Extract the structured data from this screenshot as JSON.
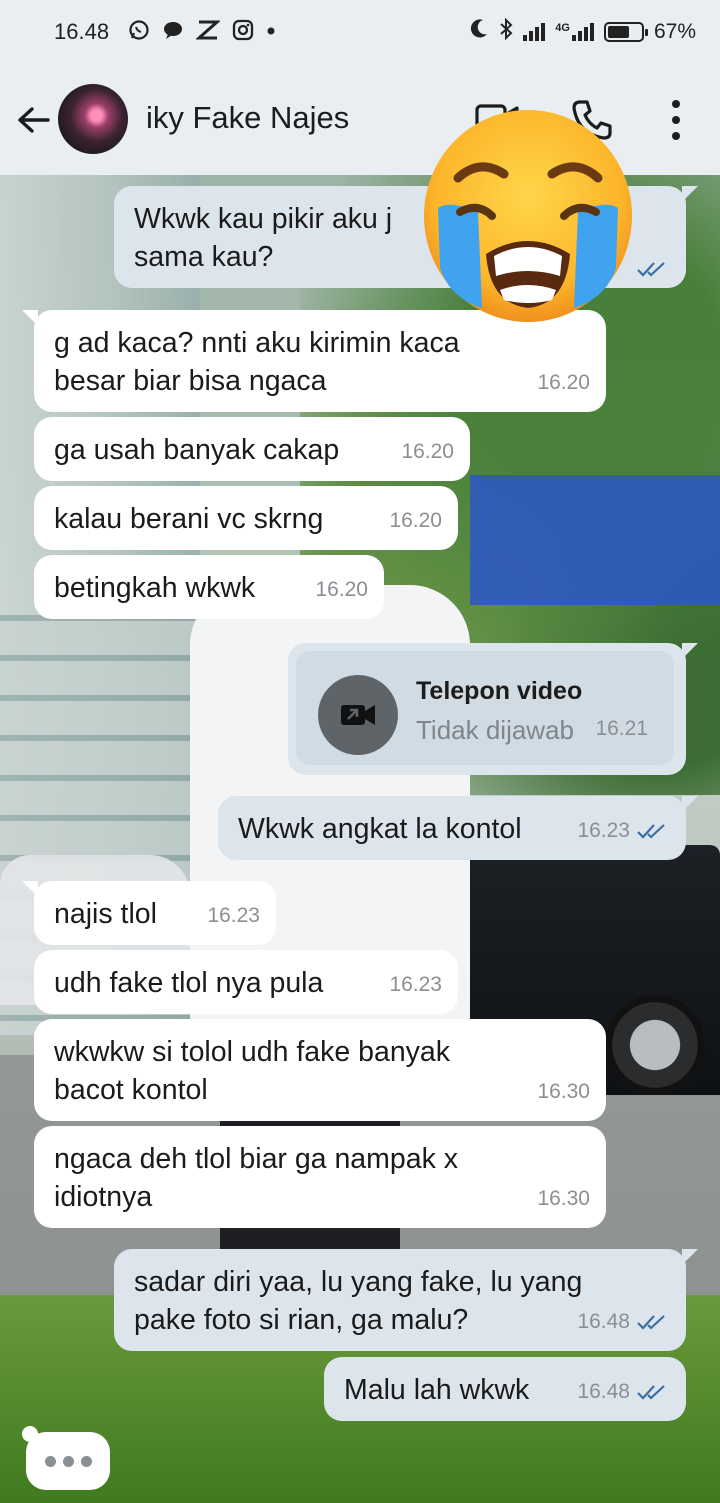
{
  "status_bar": {
    "time": "16.48",
    "network": "4G",
    "battery_percent": "67%",
    "battery_level": 0.67,
    "left_icons": [
      "whatsapp-icon",
      "chat-bubble-icon",
      "x-app-icon",
      "instagram-icon",
      "dot-icon"
    ],
    "right_icons": [
      "moon-icon",
      "bluetooth-icon",
      "signal-icon",
      "4g-signal-icon",
      "battery-icon"
    ]
  },
  "header": {
    "contact_name": "iky Fake Najes",
    "actions": [
      "back-icon",
      "video-call-icon",
      "phone-icon",
      "more-icon"
    ]
  },
  "messages": [
    {
      "dir": "out",
      "text": "Wkwk kau pikir aku j\nsama kau?",
      "time": "",
      "ticks": "read"
    },
    {
      "dir": "in",
      "text": "g ad kaca? nnti aku kirimin kaca\nbesar biar bisa ngaca",
      "time": "16.20"
    },
    {
      "dir": "in",
      "text": "ga usah banyak cakap",
      "time": "16.20"
    },
    {
      "dir": "in",
      "text": "kalau berani vc skrng",
      "time": "16.20"
    },
    {
      "dir": "in",
      "text": "betingkah wkwk",
      "time": "16.20"
    },
    {
      "dir": "out",
      "text": "Wkwk angkat la kontol",
      "time": "16.23",
      "ticks": "read"
    },
    {
      "dir": "in",
      "text": "najis tlol",
      "time": "16.23"
    },
    {
      "dir": "in",
      "text": "udh fake tlol nya pula",
      "time": "16.23"
    },
    {
      "dir": "in",
      "text": "wkwkw si tolol udh fake banyak\nbacot kontol",
      "time": "16.30"
    },
    {
      "dir": "in",
      "text": "ngaca deh tlol biar ga nampak x\nidiotnya",
      "time": "16.30"
    },
    {
      "dir": "out",
      "text": "sadar diri yaa, lu yang fake, lu yang\npake foto si rian, ga malu?",
      "time": "16.48",
      "ticks": "read"
    },
    {
      "dir": "out",
      "text": "Malu lah wkwk",
      "time": "16.48",
      "ticks": "read"
    }
  ],
  "call_card": {
    "title": "Telepon video",
    "status": "Tidak dijawab",
    "time": "16.21",
    "icon": "missed-video-call-icon"
  },
  "overlay": {
    "sticker": "loudly-crying-face-emoji"
  },
  "typing_indicator": {
    "icon": "typing-dots-icon"
  },
  "colors": {
    "header_bg": "#e9eef2",
    "incoming_bubble": "#ffffff",
    "outgoing_bubble": "#dde5ec",
    "read_tick": "#3b6ea5",
    "time_text": "#8a8f94"
  }
}
